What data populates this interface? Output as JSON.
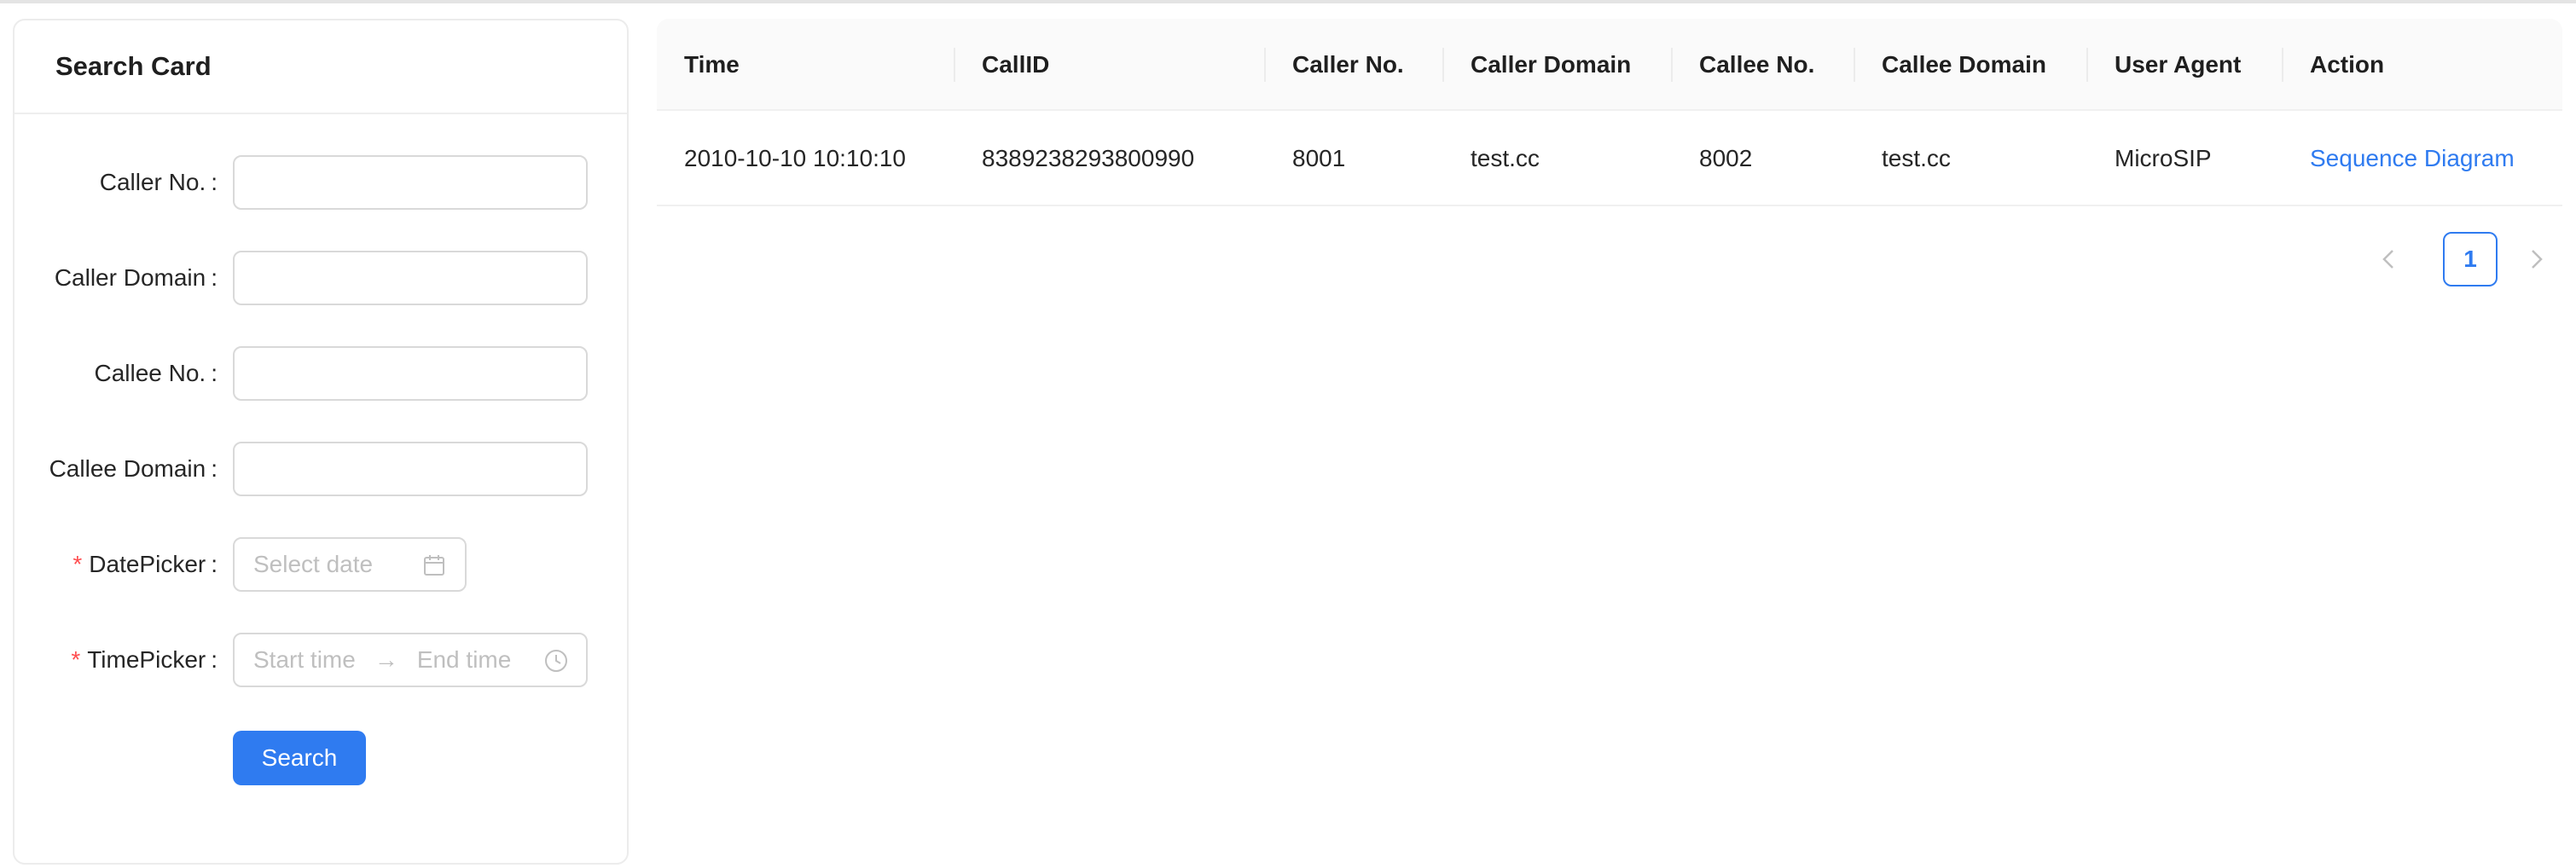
{
  "search_card": {
    "title": "Search Card",
    "fields": {
      "caller_no": {
        "label": "Caller No.",
        "value": ""
      },
      "caller_domain": {
        "label": "Caller Domain",
        "value": ""
      },
      "callee_no": {
        "label": "Callee No.",
        "value": ""
      },
      "callee_domain": {
        "label": "Callee Domain",
        "value": ""
      },
      "date_picker": {
        "label": "DatePicker",
        "required": true,
        "placeholder": "Select date",
        "icon": "calendar-icon"
      },
      "time_picker": {
        "label": "TimePicker",
        "required": true,
        "start_placeholder": "Start time",
        "end_placeholder": "End time",
        "separator": "→",
        "icon": "clock-icon"
      }
    },
    "colon": ":",
    "required_mark": "*",
    "search_button": "Search"
  },
  "table": {
    "columns": [
      "Time",
      "CallID",
      "Caller No.",
      "Caller Domain",
      "Callee No.",
      "Callee Domain",
      "User Agent",
      "Action"
    ],
    "rows": [
      {
        "time": "2010-10-10 10:10:10",
        "call_id": "8389238293800990",
        "caller_no": "8001",
        "caller_domain": "test.cc",
        "callee_no": "8002",
        "callee_domain": "test.cc",
        "user_agent": "MicroSIP",
        "action": "Sequence Diagram"
      }
    ]
  },
  "pagination": {
    "current_page": "1"
  },
  "colors": {
    "accent": "#2f7bf0",
    "required": "#ff4d4f",
    "placeholder": "#bfbfbf",
    "header_bg": "#fafafa"
  }
}
